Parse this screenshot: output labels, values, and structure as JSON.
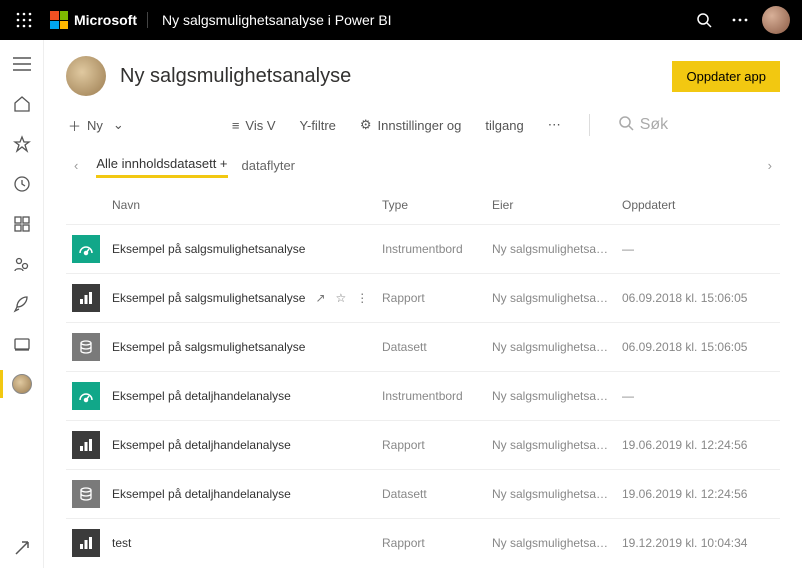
{
  "topbar": {
    "brand": "Microsoft",
    "app_title": "Ny salgsmulighetsanalyse i Power BI"
  },
  "workspace": {
    "title": "Ny salgsmulighetsanalyse",
    "update_button": "Oppdater app"
  },
  "toolbar": {
    "new_label": "Ny",
    "view_label": "Vis V",
    "filter_label": "Y-filtre",
    "settings_label": "Innstillinger og",
    "access_label": "tilgang",
    "search_placeholder": "Søk"
  },
  "tabs": {
    "all_content": "Alle innholdsdatasett +",
    "dataflows": "dataflyter"
  },
  "columns": {
    "name": "Navn",
    "type": "Type",
    "owner": "Eier",
    "updated": "Oppdatert"
  },
  "rows": [
    {
      "kind": "dash",
      "name": "Eksempel på salgsmulighetsanalyse",
      "type": "Instrumentbord",
      "owner": "Ny salgsmulighetsana…",
      "updated": "—",
      "show_actions": false
    },
    {
      "kind": "rep",
      "name": "Eksempel på salgsmulighetsanalyse",
      "type": "Rapport",
      "owner": "Ny salgsmulighetsana…",
      "updated": "06.09.2018 kl. 15:06:05",
      "show_actions": true
    },
    {
      "kind": "ds",
      "name": "Eksempel på salgsmulighetsanalyse",
      "type": "Datasett",
      "owner": "Ny salgsmulighetsana…",
      "updated": "06.09.2018 kl. 15:06:05",
      "show_actions": false
    },
    {
      "kind": "dash",
      "name": "Eksempel på detaljhandelanalyse",
      "type": "Instrumentbord",
      "owner": "Ny salgsmulighetsana…",
      "updated": "—",
      "show_actions": false
    },
    {
      "kind": "rep",
      "name": "Eksempel på detaljhandelanalyse",
      "type": "Rapport",
      "owner": "Ny salgsmulighetsana…",
      "updated": "19.06.2019 kl. 12:24:56",
      "show_actions": false
    },
    {
      "kind": "ds",
      "name": "Eksempel på detaljhandelanalyse",
      "type": "Datasett",
      "owner": "Ny salgsmulighetsana…",
      "updated": "19.06.2019 kl. 12:24:56",
      "show_actions": false
    },
    {
      "kind": "rep",
      "name": "test",
      "type": "Rapport",
      "owner": "Ny salgsmulighetsana…",
      "updated": "19.12.2019 kl. 10:04:34",
      "show_actions": false
    }
  ]
}
